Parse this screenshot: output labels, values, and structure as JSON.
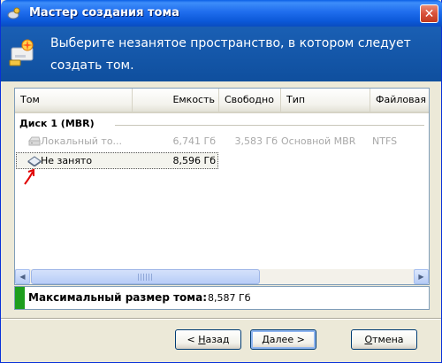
{
  "window": {
    "title": "Мастер создания тома",
    "close_label": "✕"
  },
  "header": {
    "instruction_line1": "Выберите незанятое пространство, в котором следует",
    "instruction_line2": "создать том."
  },
  "list": {
    "columns": [
      "Том",
      "Емкость",
      "Свободно",
      "Тип",
      "Файловая"
    ],
    "group_label": "Диск 1 (MBR)",
    "rows": [
      {
        "name": "Локальный то...",
        "capacity": "6,741 Гб",
        "free": "3,583 Гб",
        "type": "Основной MBR",
        "fs": "NTFS",
        "state": "disabled"
      },
      {
        "name": "Не занято",
        "capacity": "8,596 Гб",
        "free": "",
        "type": "",
        "fs": "",
        "state": "selected"
      }
    ]
  },
  "info": {
    "label": "Максимальный размер тома:",
    "value": "8,587 Гб",
    "swatch_color": "#1e9e1e"
  },
  "buttons": {
    "back_accel": "Н",
    "back_rest": "азад",
    "back_prefix": "< ",
    "next_accel": "Д",
    "next_rest": "алее >",
    "cancel_accel": "О",
    "cancel_rest": "тмена"
  },
  "icons": {
    "title": "disk-wizard-icon",
    "header": "new-volume-icon",
    "row_volume": "drive-icon",
    "row_unallocated": "unallocated-disk-icon",
    "annotation": "red-arrow-annotation"
  }
}
